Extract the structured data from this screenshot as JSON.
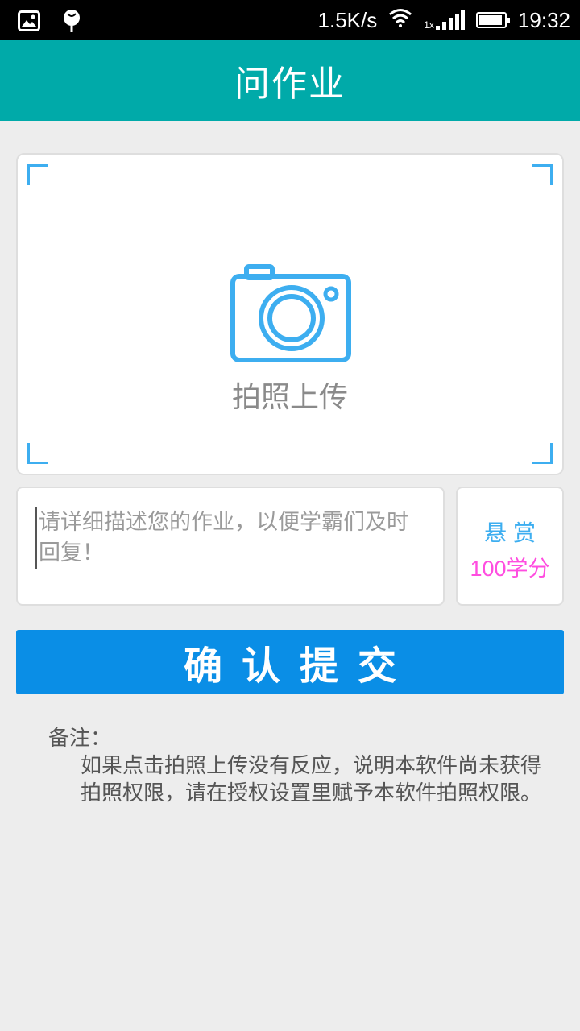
{
  "status_bar": {
    "net_speed": "1.5K/s",
    "signal_label": "1x",
    "time": "19:32"
  },
  "header": {
    "title": "问作业"
  },
  "photo_upload": {
    "label": "拍照上传",
    "accent_color": "#3daef0"
  },
  "description": {
    "placeholder": "请详细描述您的作业，以便学霸们及时回复！"
  },
  "reward": {
    "label": "悬赏",
    "value": "100学分"
  },
  "submit": {
    "label": "确认提交"
  },
  "note": {
    "title": "备注：",
    "body": "如果点击拍照上传没有反应，说明本软件尚未获得拍照权限，请在授权设置里赋予本软件拍照权限。"
  },
  "colors": {
    "header_bg": "#00aaa9",
    "button_bg": "#0a8ee6",
    "reward_value": "#ff4de0"
  }
}
